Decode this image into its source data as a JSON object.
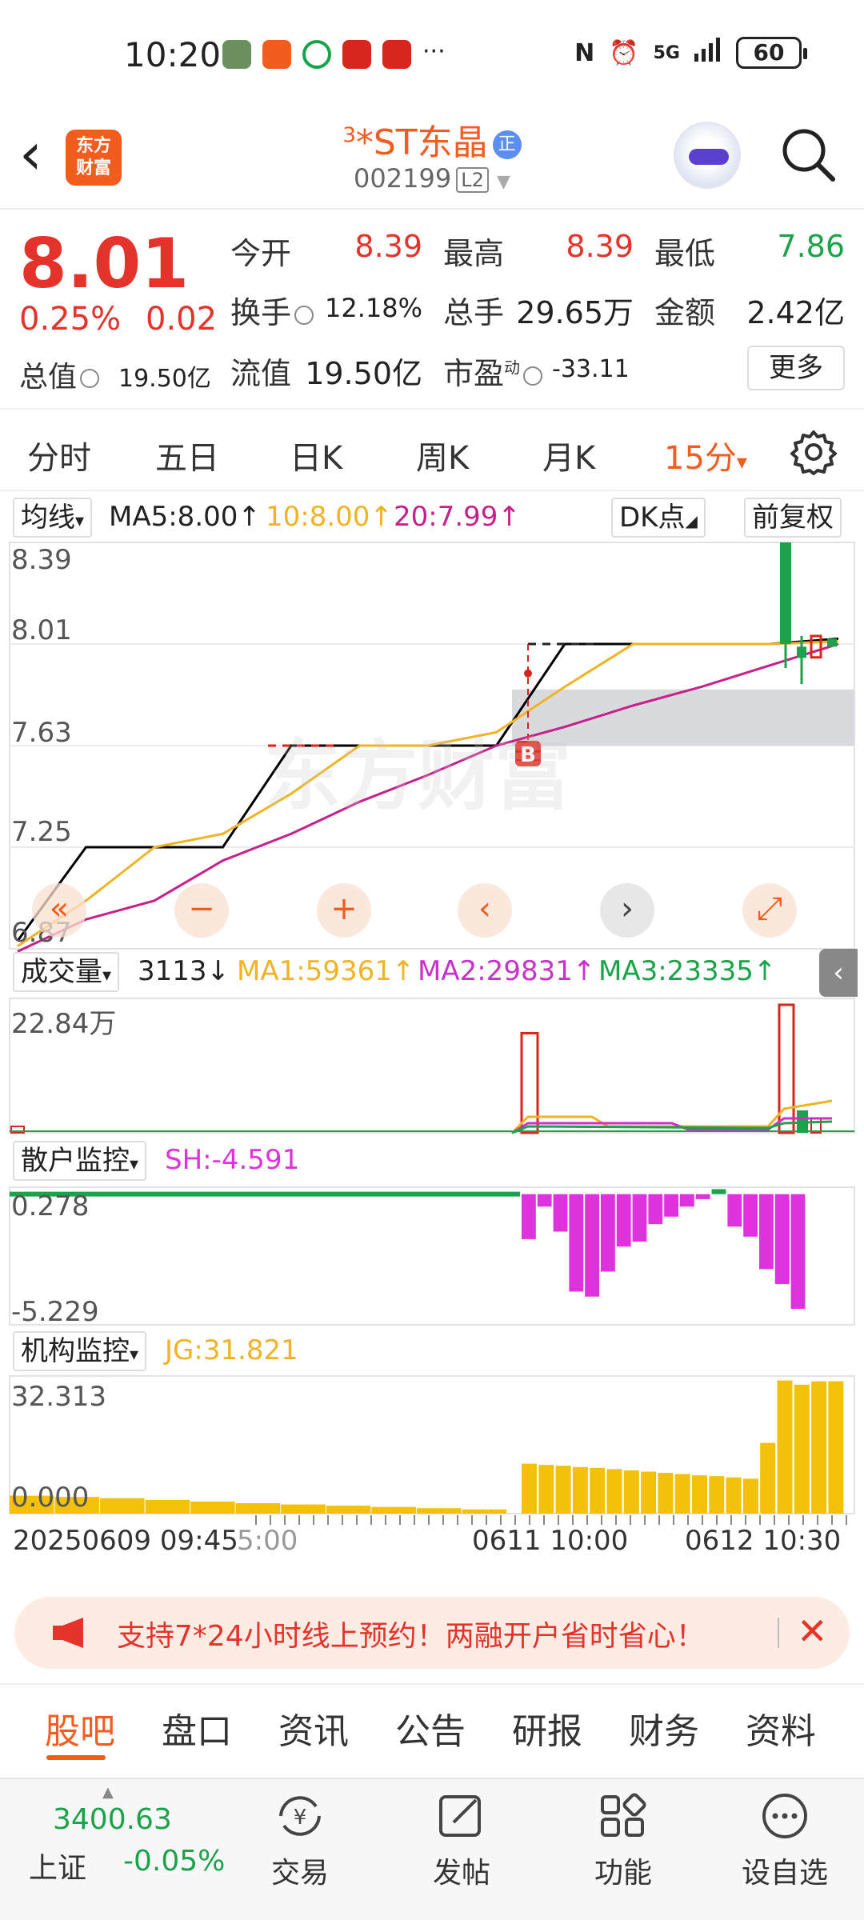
{
  "status": {
    "time": "10:20",
    "network": "5G",
    "battery": "60",
    "more": "···"
  },
  "header": {
    "logo_text_line1": "东方",
    "logo_text_line2": "财富",
    "stock_prefix": "3",
    "stock_name": "*ST东晶",
    "badge": "正",
    "code": "002199",
    "level": "L2"
  },
  "quote": {
    "price": "8.01",
    "pct": "0.25%",
    "change": "0.02",
    "total_value_label": "总值",
    "total_value": "19.50亿",
    "open_label": "今开",
    "open": "8.39",
    "high_label": "最高",
    "high": "8.39",
    "low_label": "最低",
    "low": "7.86",
    "turnover_label": "换手",
    "turnover": "12.18%",
    "volume_label": "总手",
    "volume": "29.65万",
    "amount_label": "金额",
    "amount": "2.42亿",
    "float_label": "流值",
    "float_value": "19.50亿",
    "pe_label": "市盈",
    "pe_sup": "动",
    "pe": "-33.11",
    "more_label": "更多",
    "colors": {
      "up": "#e4332a",
      "down": "#1aa34a"
    }
  },
  "tabs": {
    "items": [
      "分时",
      "五日",
      "日K",
      "周K",
      "月K"
    ],
    "active": "15分",
    "active_arrow": "▾"
  },
  "chart": {
    "ma_select": "均线",
    "ma5": "MA5:8.00↑",
    "ma10": "10:8.00↑",
    "ma20": "20:7.99↑",
    "dk_label": "DK点",
    "fq_label": "前复权",
    "y_labels": [
      "8.39",
      "8.01",
      "7.63",
      "7.25",
      "6.87"
    ],
    "b_marker": "B",
    "watermark": "东方财富",
    "volume_select": "成交量",
    "volume_val": "3113↓",
    "vol_ma1": "MA1:59361↑",
    "vol_ma2": "MA2:29831↑",
    "vol_ma3": "MA3:23335↑",
    "vol_max": "22.84万",
    "retail_select": "散户监控",
    "retail_val": "SH:-4.591",
    "retail_top": "0.278",
    "retail_bottom": "-5.229",
    "inst_select": "机构监控",
    "inst_val": "JG:31.821",
    "inst_top": "32.313",
    "inst_bottom": "0.000",
    "x_label_1": "20250609 09:45",
    "x_label_1b": "5:00",
    "x_label_2": "0611 10:00",
    "x_label_3": "0612 10:30",
    "colors": {
      "ma5": "#000000",
      "ma10": "#f0b323",
      "ma20": "#c8208a",
      "vol_ma1": "#f0b323",
      "vol_ma2": "#c832c8",
      "vol_ma3": "#1aa34a",
      "retail": "#dd33dd",
      "inst": "#f3c10a"
    }
  },
  "chart_data": [
    {
      "type": "line",
      "title": "",
      "x": [
        0,
        1,
        2,
        3,
        4,
        5,
        6,
        7,
        8,
        9,
        10,
        11,
        12
      ],
      "series": [
        {
          "name": "MA5",
          "values": [
            6.9,
            7.25,
            7.25,
            7.25,
            7.63,
            7.63,
            7.63,
            7.63,
            8.01,
            8.01,
            8.01,
            8.01,
            8.03
          ]
        },
        {
          "name": "10",
          "values": [
            6.88,
            7.05,
            7.25,
            7.3,
            7.45,
            7.63,
            7.63,
            7.68,
            7.85,
            8.01,
            8.01,
            8.01,
            8.02
          ]
        },
        {
          "name": "20",
          "values": [
            6.86,
            6.98,
            7.05,
            7.2,
            7.3,
            7.42,
            7.52,
            7.63,
            7.7,
            7.78,
            7.85,
            7.93,
            8.01
          ]
        }
      ],
      "ylim": [
        6.87,
        8.39
      ]
    },
    {
      "type": "bar",
      "title": "成交量",
      "values": [
        1200,
        200,
        200,
        300,
        800,
        1500,
        180000,
        12000,
        228400,
        60000,
        22000,
        3113
      ],
      "ylim": [
        0,
        228400
      ]
    },
    {
      "type": "bar",
      "title": "散户监控",
      "values": [
        0.1,
        0.1,
        0.1,
        0.05,
        -1.8,
        -0.5,
        -1.5,
        -3.9,
        -4.1,
        -3.1,
        -2.1,
        -1.9,
        -1.2,
        -0.9,
        -0.5,
        -0.2,
        0.2,
        -1.3,
        -1.7,
        -3.0,
        -3.6,
        -4.591
      ],
      "ylim": [
        -5.229,
        0.278
      ]
    },
    {
      "type": "bar",
      "title": "机构监控",
      "values": [
        4.3,
        4.0,
        3.7,
        3.3,
        2.9,
        2.5,
        2.2,
        1.9,
        1.6,
        1.3,
        1.0,
        12.0,
        11.7,
        11.5,
        11.2,
        11.0,
        10.7,
        10.4,
        10.1,
        9.8,
        9.5,
        9.2,
        9.0,
        8.7,
        8.4,
        17.0,
        32.0,
        31.0,
        31.8,
        31.821
      ],
      "ylim": [
        0,
        32.313
      ]
    }
  ],
  "banner": {
    "text": "支持7*24小时线上预约！两融开户省时省心！"
  },
  "sub_tabs": {
    "items": [
      "股吧",
      "盘口",
      "资讯",
      "公告",
      "研报",
      "财务",
      "资料"
    ]
  },
  "bottom_nav": {
    "index_value": "3400.63",
    "index_name": "上证",
    "index_pct": "-0.05%",
    "items": [
      "交易",
      "发帖",
      "功能",
      "设自选"
    ]
  }
}
